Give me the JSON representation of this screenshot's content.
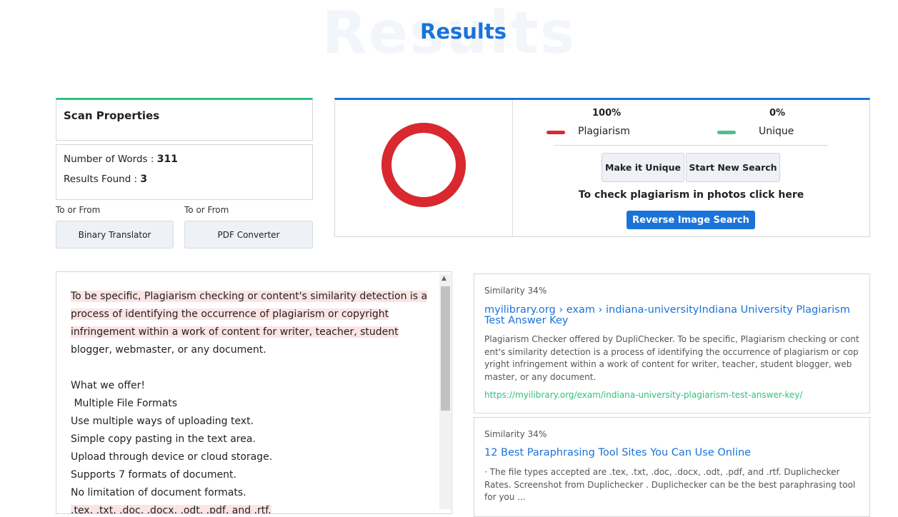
{
  "header": {
    "title": "Results",
    "background_word": "Results"
  },
  "scan_properties": {
    "title": "Scan Properties",
    "words_label": "Number of Words :",
    "words_value": "311",
    "results_label": "Results Found :",
    "results_value": "3"
  },
  "tools": [
    {
      "caption": "To or From",
      "label": "Binary Translator"
    },
    {
      "caption": "To or From",
      "label": "PDF Converter"
    }
  ],
  "result": {
    "plagiarism_percent": "100%",
    "plagiarism_label": "Plagiarism",
    "unique_percent": "0%",
    "unique_label": "Unique",
    "plagiarism_fraction": 1.0,
    "make_unique_label": "Make it Unique",
    "new_search_label": "Start New Search",
    "photo_text": "To check plagiarism in photos click here",
    "reverse_label": "Reverse Image Search"
  },
  "colors": {
    "plagiarism": "#d9282f",
    "unique": "#4cc08e",
    "accent": "#1a73d9",
    "unique_border": "#2ec27e"
  },
  "text_panel": {
    "highlight": "To be specific, Plagiarism checking or content's similarity detection is a process of identifying the occurrence of plagiarism or copyright infringement within a work of content for writer, teacher, student",
    "rest": " blogger, webmaster, or any document.",
    "lines": [
      "What we offer!",
      " Multiple File Formats",
      "Use multiple ways of uploading text.",
      "Simple copy pasting in the text area.",
      "Upload through device or cloud storage.",
      "Supports 7 formats of document.",
      "No limitation of document formats."
    ],
    "partial_line": ".tex, .txt, .doc, .docx, .odt, .pdf, and .rtf."
  },
  "sources": [
    {
      "similarity": "Similarity 34%",
      "title": "myilibrary.org › exam › indiana-universityIndiana University Plagiarism Test Answer Key",
      "description": "Plagiarism Checker offered by DupliChecker. To be specific, Plagiarism checking or content's similarity detection is a process of identifying the occurrence of plagiarism or copyright infringement within a work of content for writer, teacher, student blogger, webmaster, or any document.",
      "url": "https://myilibrary.org/exam/indiana-university-plagiarism-test-answer-key/"
    },
    {
      "similarity": "Similarity 34%",
      "title": "12 Best Paraphrasing Tool Sites You Can Use Online",
      "description": " · The file types accepted are .tex, .txt, .doc, .docx, .odt, .pdf, and .rtf. Duplichecker Rates. Screenshot from Duplichecker . Duplichecker can be the best paraphrasing tool for you ..."
    }
  ]
}
